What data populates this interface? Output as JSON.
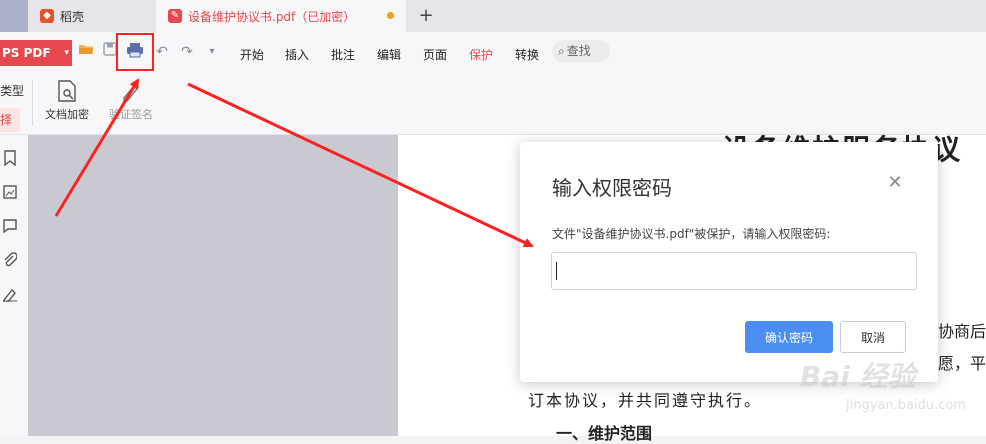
{
  "tabs": [
    {
      "label": "稻壳",
      "icon": "docer-logo-icon"
    },
    {
      "label": "设备维护协议书.pdf（已加密）",
      "icon": "pdf-file-icon",
      "modified_dot": true
    }
  ],
  "new_tab_label": "+",
  "toolbar": {
    "app_menu_label": "PS PDF",
    "app_menu_chevron": "▾",
    "quick_icons": [
      "open-folder-icon",
      "save-icon",
      "print-icon",
      "undo-icon",
      "redo-icon",
      "dropdown-icon"
    ],
    "menu_items": [
      "开始",
      "插入",
      "批注",
      "编辑",
      "页面",
      "保护",
      "转换"
    ],
    "active_menu": "保护",
    "search_label": "查找"
  },
  "ribbon": {
    "side_label_1": "类型",
    "side_label_2": "择",
    "buttons": [
      {
        "label": "文档加密",
        "icon": "document-encrypt-icon"
      },
      {
        "label": "验证签名",
        "icon": "verify-signature-icon"
      }
    ]
  },
  "left_rail_icons": [
    "bookmark-icon",
    "thumbnail-icon",
    "comment-icon",
    "attachment-icon",
    "signature-icon"
  ],
  "document": {
    "title": "设备维护服务协议",
    "frag_1": "协商后",
    "frag_2": "愿，平",
    "line": "订本协议，并共同遵守执行。",
    "heading": "一、维护范围"
  },
  "dialog": {
    "title": "输入权限密码",
    "message": "文件\"设备维护协议书.pdf\"被保护，请输入权限密码:",
    "input_value": "",
    "input_placeholder": "",
    "confirm_label": "确认密码",
    "cancel_label": "取消"
  },
  "watermark": {
    "text": "Bai 经验",
    "sub": "jingyan.baidu.com"
  },
  "colors": {
    "accent_red": "#e5484d",
    "primary_blue": "#4a8ef0",
    "annotation_red": "#ff2020"
  }
}
